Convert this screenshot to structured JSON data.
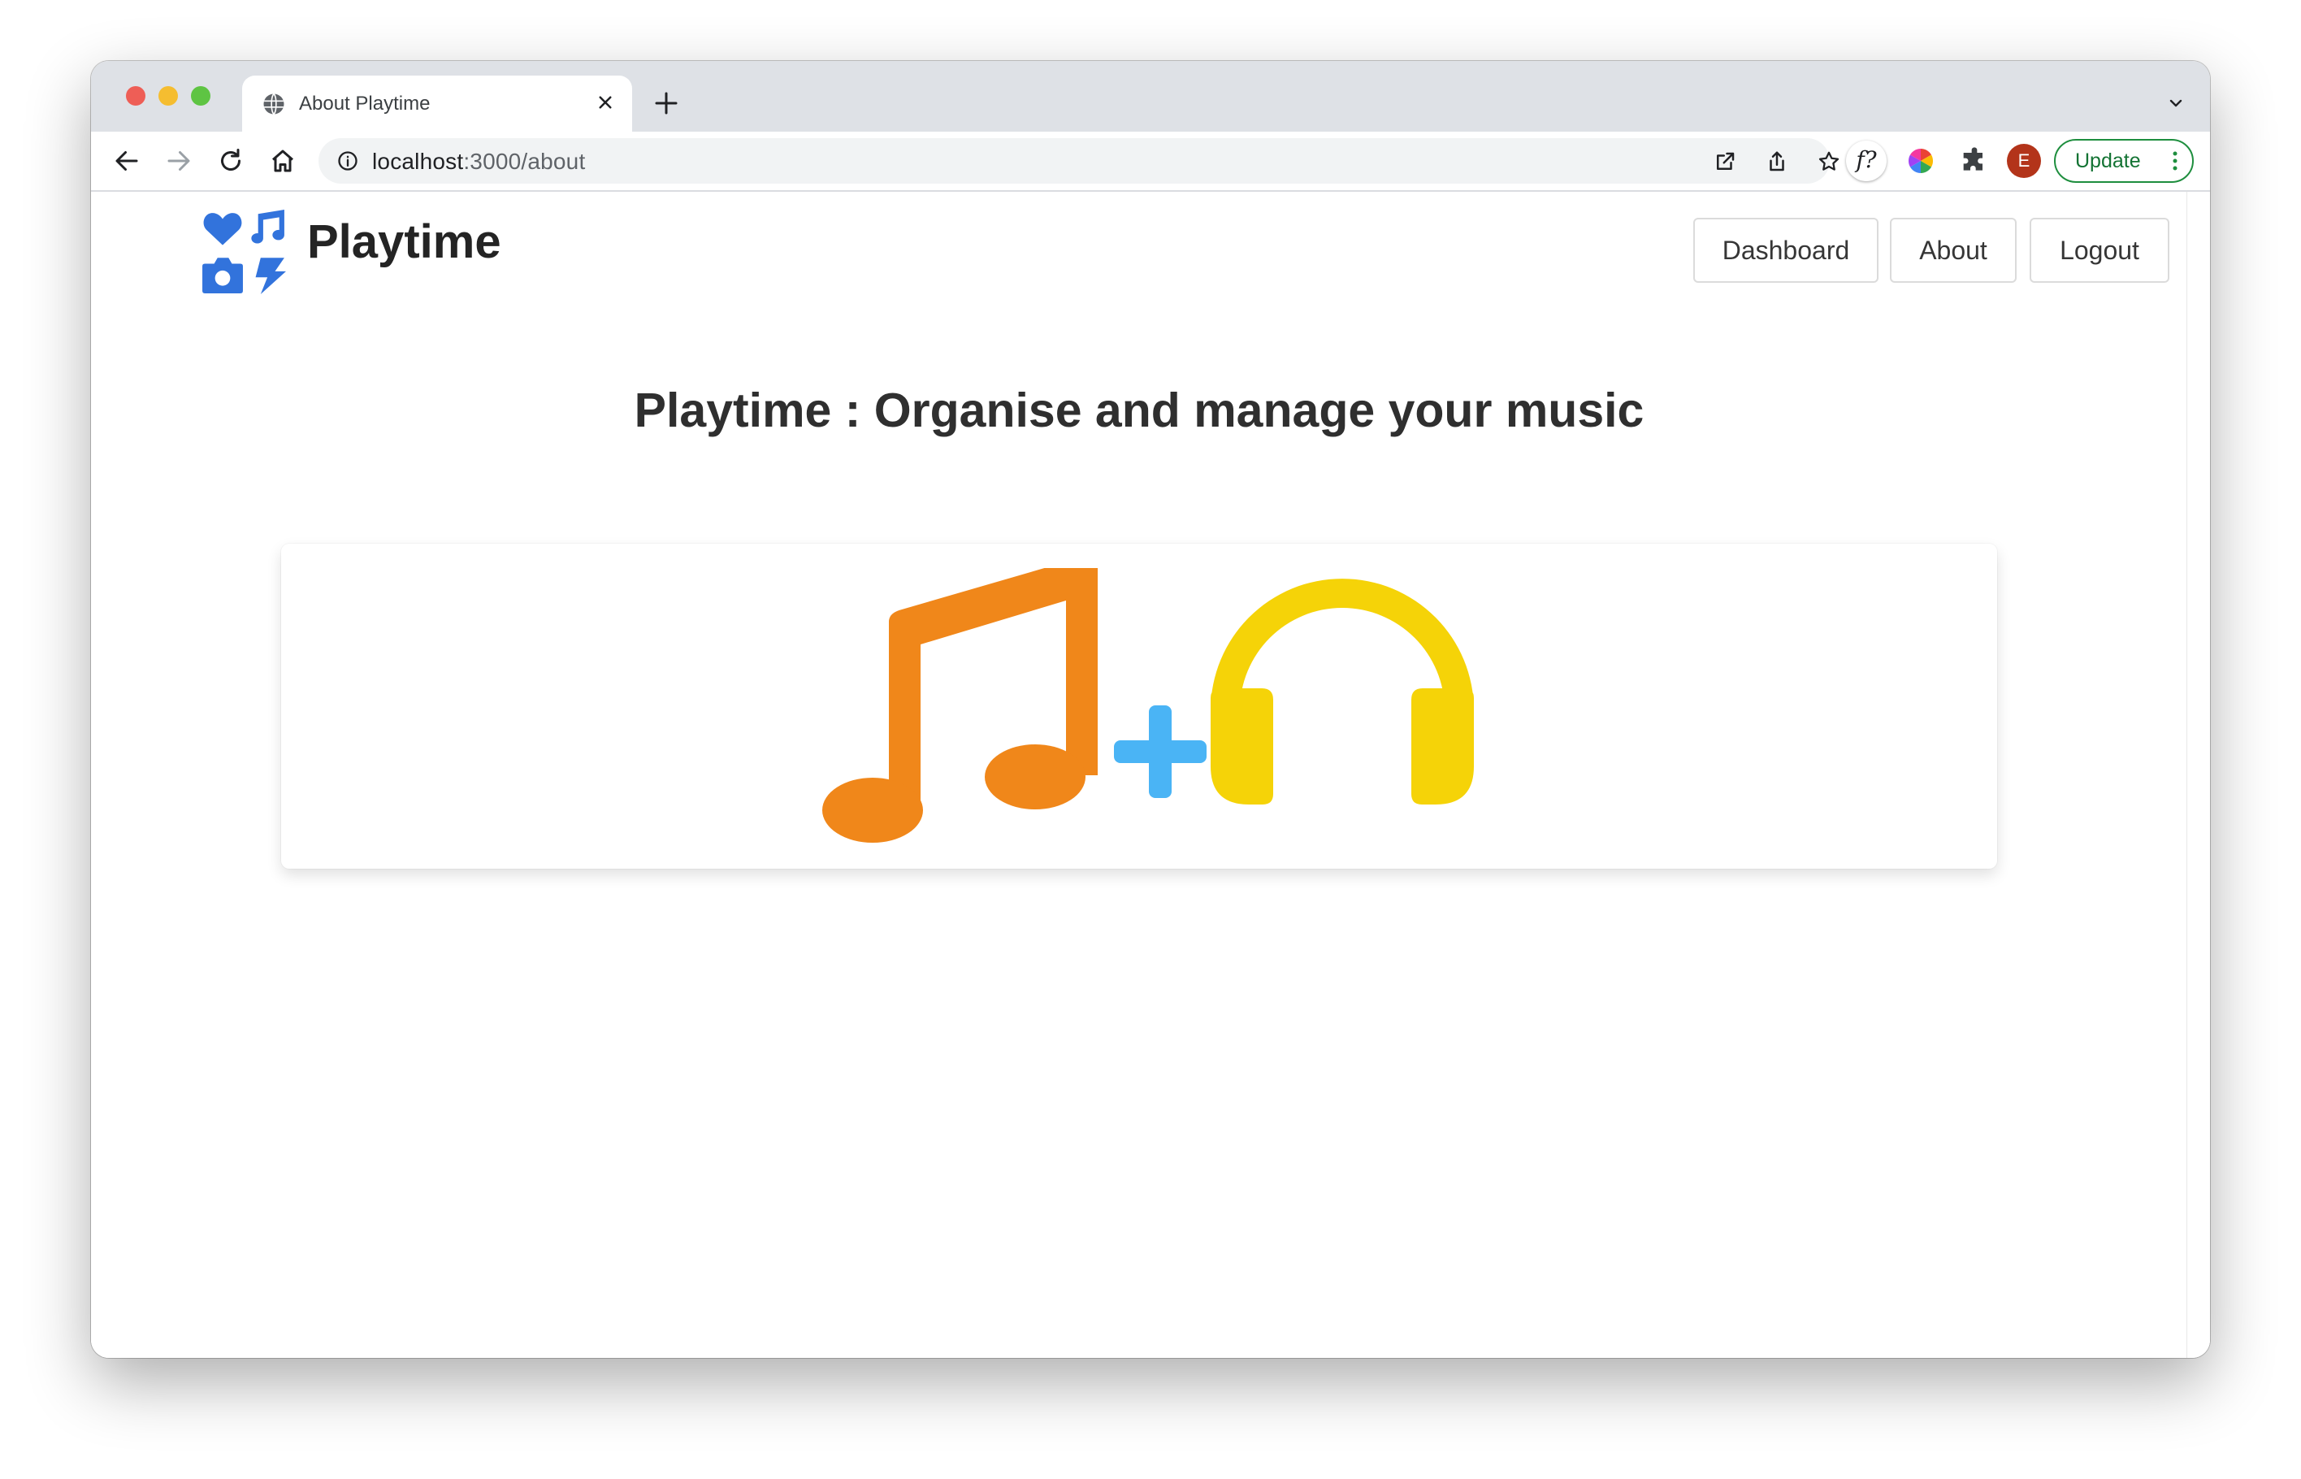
{
  "browser": {
    "tab_title": "About Playtime",
    "url_host": "localhost",
    "url_path": ":3000/about",
    "profile_initial": "E",
    "update_label": "Update",
    "extension_label": "f?"
  },
  "page": {
    "brand_name": "Playtime",
    "nav": {
      "dashboard": "Dashboard",
      "about": "About",
      "logout": "Logout"
    },
    "heading": "Playtime : Organise and manage your music"
  },
  "colors": {
    "accent": "#3273dc",
    "note": "#f0871a",
    "plus": "#4ab4f5",
    "headphones": "#f5d308",
    "update_green": "#1e8e3e"
  },
  "icons": [
    "globe-icon",
    "close-icon",
    "plus-icon",
    "chevron-down-icon",
    "back-icon",
    "forward-icon",
    "reload-icon",
    "home-icon",
    "info-icon",
    "open-external-icon",
    "share-icon",
    "star-icon",
    "color-wheel-icon",
    "puzzle-icon",
    "more-vertical-icon",
    "music-note-icon",
    "headphones-icon"
  ]
}
